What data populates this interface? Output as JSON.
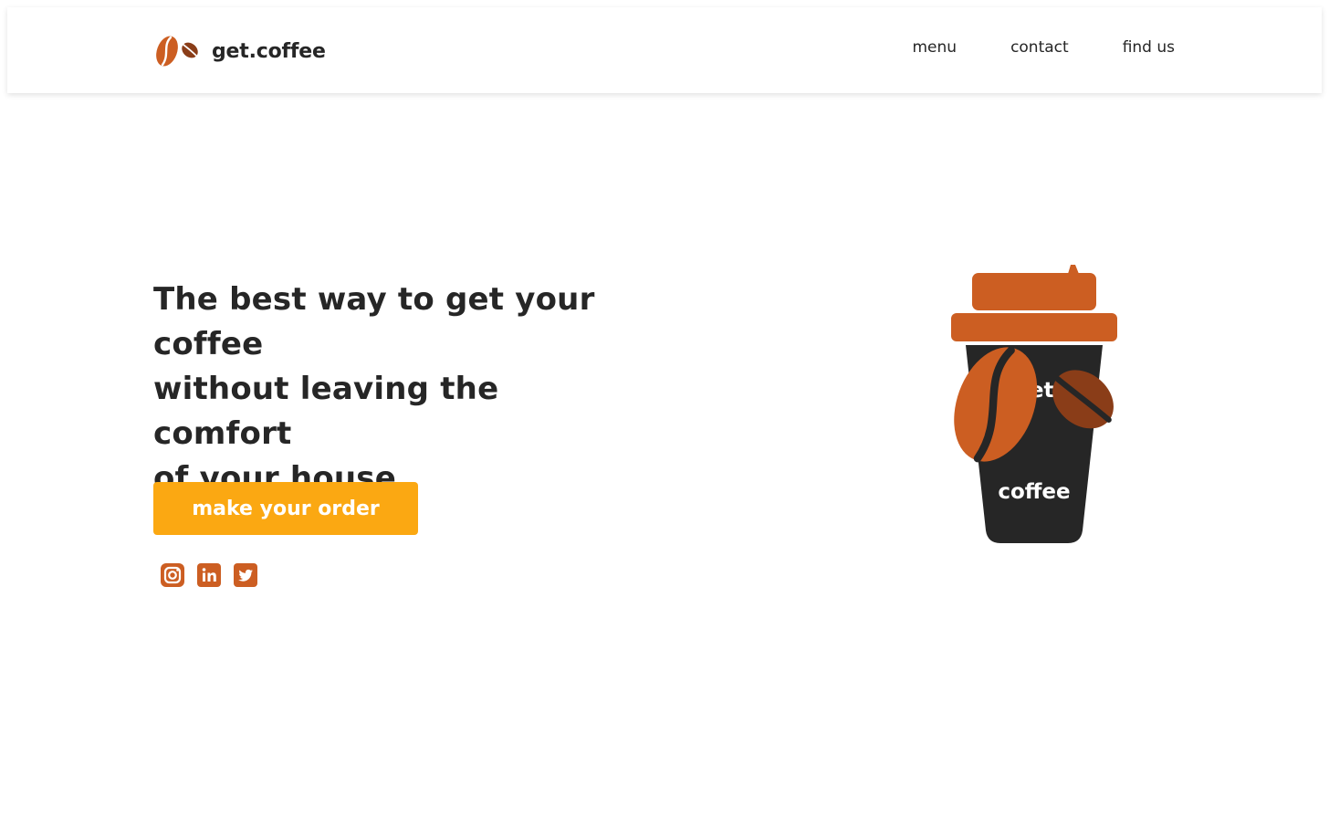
{
  "brand": {
    "name": "get.coffee",
    "logo_icon": "coffee-beans-icon"
  },
  "nav": {
    "items": [
      {
        "label": "menu"
      },
      {
        "label": "contact"
      },
      {
        "label": "find us"
      }
    ]
  },
  "hero": {
    "headline_lines": [
      "The best way to get your",
      "coffee",
      "without leaving the comfort",
      "of your house"
    ],
    "cta_label": "make your order"
  },
  "socials": [
    {
      "icon": "instagram-icon"
    },
    {
      "icon": "linkedin-icon"
    },
    {
      "icon": "twitter-icon"
    }
  ],
  "cup": {
    "top_text": "get",
    "bottom_text": "coffee",
    "icon": "coffee-beans-icon"
  },
  "colors": {
    "accent_orange": "#CC5E22",
    "bean_dark": "#8A3D18",
    "button_yellow": "#FBA812",
    "cup_black": "#262626",
    "text_dark": "#262626"
  }
}
